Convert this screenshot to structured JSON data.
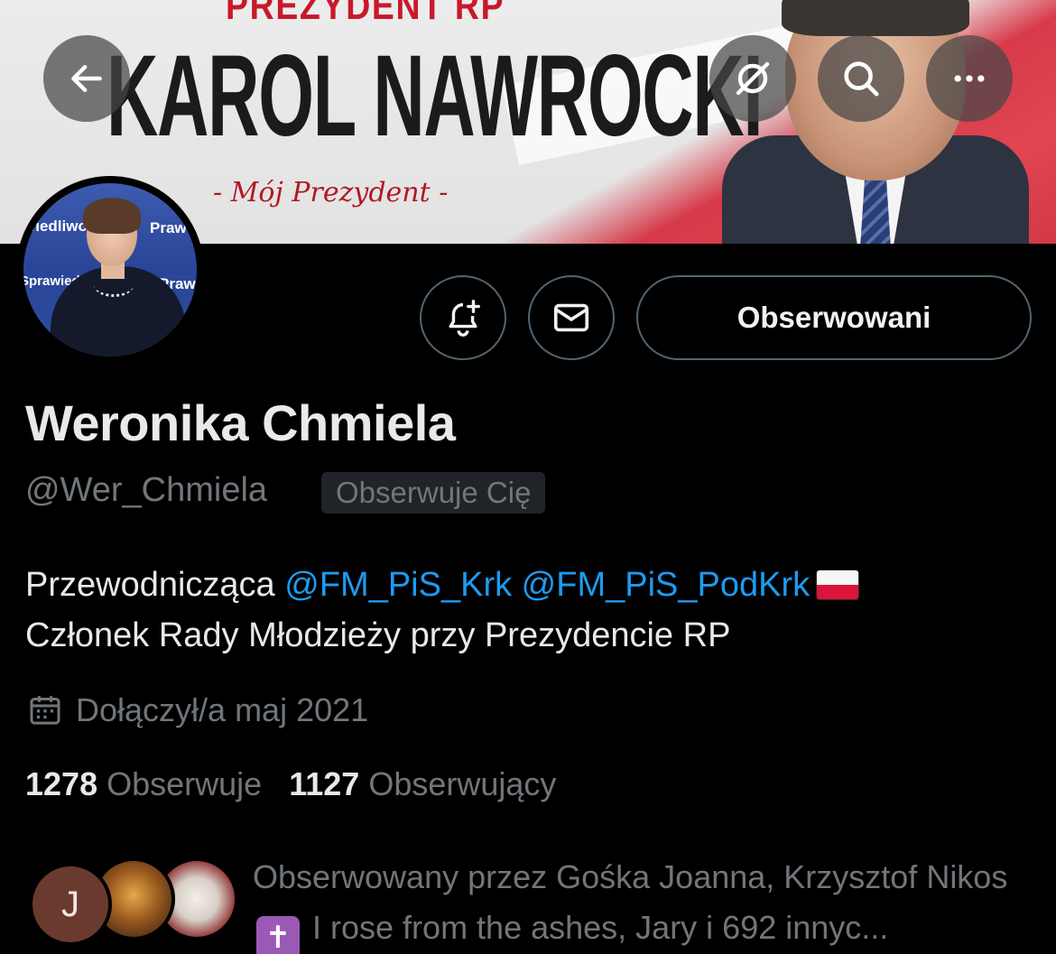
{
  "banner": {
    "sup_text": "PREZYDENT RP",
    "name_text": "KAROL NAWROCKI",
    "tagline": "- Mój Prezydent -"
  },
  "avatar_text": {
    "line1": "Prawo",
    "line2": "wiedliwość",
    "line3": "Prawo i",
    "line4": "Sprawiedliwość"
  },
  "top_nav": {
    "back_icon": "arrow-left-icon",
    "grok_icon": "grok-icon",
    "search_icon": "search-icon",
    "more_icon": "more-horizontal-icon"
  },
  "actions": {
    "notify_icon": "bell-plus-icon",
    "message_icon": "envelope-icon",
    "following_label": "Obserwowani"
  },
  "profile": {
    "display_name": "Weronika Chmiela",
    "handle": "@Wer_Chmiela",
    "follows_you": "Obserwuje Cię",
    "bio_prefix": "Przewodnicząca",
    "bio_mention1": "@FM_PiS_Krk",
    "bio_mention2": "@FM_PiS_PodKrk",
    "bio_line2": "Członek Rady Młodzieży przy Prezydencie RP",
    "joined": "Dołączył/a maj 2021",
    "following_count": "1278",
    "following_label": "Obserwuje",
    "followers_count": "1127",
    "followers_label": "Obserwujący"
  },
  "followers_you_know": {
    "avatar1_letter": "J",
    "text_part1": "Obserwowany przez Gośka Joanna, Krzysztof Nikos",
    "cross_glyph": "✝",
    "text_part2": "I rose from the ashes, Jary i 692 innyc..."
  },
  "colors": {
    "background": "#000000",
    "text_primary": "#e7e9ea",
    "text_secondary": "#71767b",
    "link": "#1d9bf0",
    "border": "#536471"
  }
}
